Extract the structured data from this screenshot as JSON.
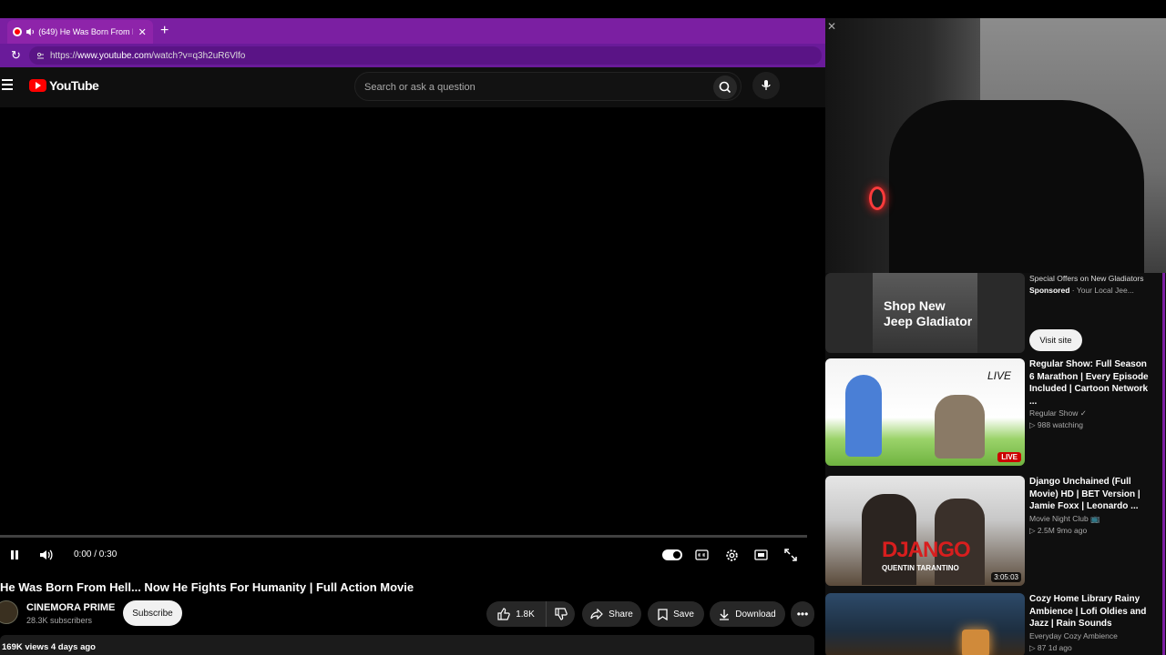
{
  "browser": {
    "tab_title": "(649) He Was Born From Hell...",
    "url_prefix": "https://",
    "url_host": "www.youtube.com",
    "url_path": "/watch?v=q3h2uR6Vlfo"
  },
  "youtube": {
    "logo": "YouTube",
    "search_placeholder": "Search or ask a question"
  },
  "player": {
    "time": "0:00 / 0:30",
    "progress": 0
  },
  "video": {
    "title": "He Was Born From Hell... Now He Fights For Humanity | Full Action Movie",
    "channel": "CINEMORA PRIME",
    "subscribers": "28.3K subscribers",
    "subscribe_label": "Subscribe",
    "likes": "1.8K",
    "share_label": "Share",
    "save_label": "Save",
    "download_label": "Download",
    "views_date": "169K views  4 days ago"
  },
  "sidebar": {
    "ad": {
      "thumb_text": "Shop New Jeep Gladiator",
      "title": "Special Offers on New Gladiators",
      "sponsored": "Sponsored",
      "advertiser": "· Your Local Jee...",
      "button": "Visit site"
    },
    "items": [
      {
        "title": "Regular Show: Full Season 6 Marathon | Every Episode Included | Cartoon Network ...",
        "channel": "Regular Show ✓",
        "meta": "▷ 988 watching",
        "badge": "LIVE",
        "thumb_label": "LIVE"
      },
      {
        "title": "Django Unchained (Full Movie) HD | BET Version | Jamie Foxx | Leonardo ...",
        "channel": "Movie Night Club 📺",
        "meta": "▷ 2.5M  9mo ago",
        "badge": "3:05:03",
        "thumb_label": "DJANGO",
        "thumb_sub": "QUENTIN TARANTINO"
      },
      {
        "title": "Cozy Home Library Rainy Ambience | Lofi Oldies and Jazz | Rain Sounds",
        "channel": "Everyday Cozy Ambience",
        "meta": "▷ 87  1d ago"
      }
    ]
  },
  "colors": {
    "browser_accent": "#7b1fa2",
    "yt_bg": "#0f0f0f",
    "yt_red": "#ff0000",
    "live_red": "#cc0000"
  }
}
